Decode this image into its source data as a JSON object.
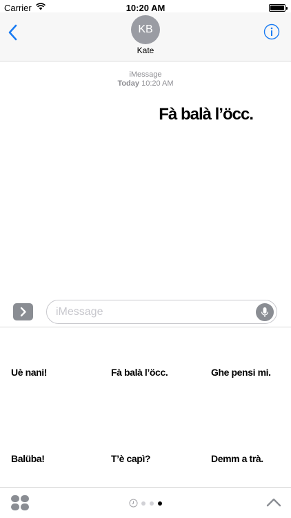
{
  "status_bar": {
    "carrier": "Carrier",
    "time": "10:20 AM"
  },
  "header": {
    "avatar_initials": "KB",
    "contact_name": "Kate"
  },
  "conversation": {
    "service": "iMessage",
    "day": "Today",
    "time": "10:20 AM",
    "sent_sticker": "Fà balà l’öcc."
  },
  "input": {
    "placeholder": "iMessage"
  },
  "stickers": [
    "Uè nani!",
    "Fà balà l’öcc.",
    "Ghe pensi mi.",
    "Balüba!",
    "T’è capì?",
    "Demm a trà."
  ],
  "pager": {
    "page_count": 3,
    "active_page": 3
  },
  "colors": {
    "accent": "#1a7cf3",
    "gray_button": "#8a8d93",
    "avatar": "#9a9ca3",
    "meta_text": "#8e8e93"
  }
}
